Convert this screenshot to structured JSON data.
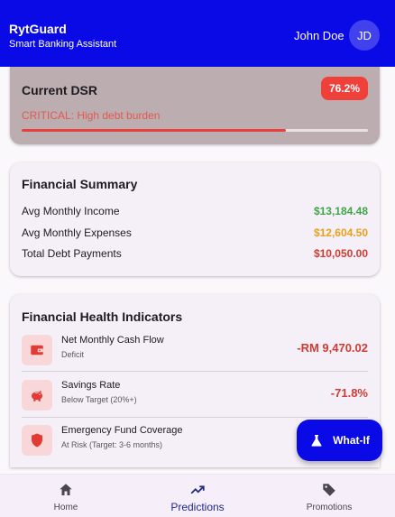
{
  "header": {
    "brand": "RytGuard",
    "subtitle": "Smart Banking Assistant",
    "user_name": "John Doe",
    "avatar_initials": "JD",
    "color": "#0a0ae6"
  },
  "dsr": {
    "title": "Current DSR",
    "badge": "76.2%",
    "status": "CRITICAL: High debt burden",
    "progress": 0.762,
    "badge_color": "#f0403a"
  },
  "summary": {
    "title": "Financial Summary",
    "rows": [
      {
        "label": "Avg Monthly Income",
        "value": "$13,184.48",
        "color": "#3fa64a"
      },
      {
        "label": "Avg Monthly Expenses",
        "value": "$12,604.50",
        "color": "#e9a01c"
      },
      {
        "label": "Total Debt Payments",
        "value": "$10,050.00",
        "color": "#d13c32"
      }
    ]
  },
  "health": {
    "title": "Financial Health Indicators",
    "items": [
      {
        "name": "Net Monthly Cash Flow",
        "sub": "Deficit",
        "value": "-RM 9,470.02",
        "icon": "wallet-icon"
      },
      {
        "name": "Savings Rate",
        "sub": "Below Target (20%+)",
        "value": "-71.8%",
        "icon": "piggy-bank-icon"
      },
      {
        "name": "Emergency Fund Coverage",
        "sub": "At Risk (Target: 3-6 months)",
        "value": "",
        "icon": "shield-icon"
      }
    ]
  },
  "fab": {
    "label": "What-If",
    "icon": "flask-icon"
  },
  "nav": {
    "items": [
      {
        "label": "Home",
        "icon": "home-icon"
      },
      {
        "label": "Predictions",
        "icon": "trending-up-icon",
        "active": true
      },
      {
        "label": "Promotions",
        "icon": "tag-icon"
      }
    ]
  }
}
